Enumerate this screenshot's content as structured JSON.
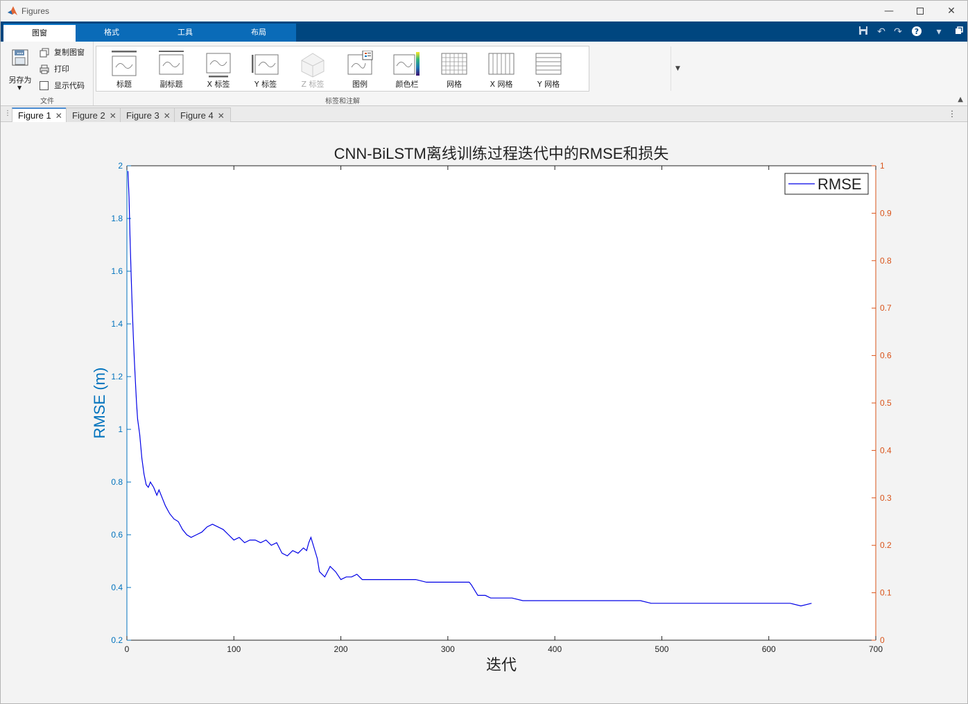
{
  "window": {
    "title": "Figures"
  },
  "ribbon": {
    "tabs": [
      "图窗",
      "格式",
      "工具",
      "布局"
    ],
    "file_section": {
      "save_as": "另存为",
      "copy_figure": "复制图窗",
      "print": "打印",
      "show_code": "显示代码",
      "label": "文件"
    },
    "annotation_section": {
      "label": "标签和注解",
      "items": [
        {
          "label": "标题",
          "icon": "title-icon",
          "enabled": true
        },
        {
          "label": "副标题",
          "icon": "subtitle-icon",
          "enabled": true
        },
        {
          "label": "X 标签",
          "icon": "xlabel-icon",
          "enabled": true
        },
        {
          "label": "Y 标签",
          "icon": "ylabel-icon",
          "enabled": true
        },
        {
          "label": "Z 标签",
          "icon": "zlabel-icon",
          "enabled": false
        },
        {
          "label": "图例",
          "icon": "legend-icon",
          "enabled": true
        },
        {
          "label": "颜色栏",
          "icon": "colorbar-icon",
          "enabled": true
        },
        {
          "label": "网格",
          "icon": "grid-icon",
          "enabled": true
        },
        {
          "label": "X 网格",
          "icon": "xgrid-icon",
          "enabled": true
        },
        {
          "label": "Y 网格",
          "icon": "ygrid-icon",
          "enabled": true
        }
      ]
    }
  },
  "doc_tabs": [
    {
      "label": "Figure 1",
      "active": true
    },
    {
      "label": "Figure 2",
      "active": false
    },
    {
      "label": "Figure 3",
      "active": false
    },
    {
      "label": "Figure 4",
      "active": false
    }
  ],
  "chart_data": {
    "type": "line",
    "title": "CNN-BiLSTM离线训练过程迭代中的RMSE和损失",
    "xlabel": "迭代",
    "ylabel": "RMSE (m)",
    "xlim": [
      0,
      700
    ],
    "ylim": [
      0.2,
      2
    ],
    "y2lim": [
      0,
      1
    ],
    "xticks": [
      "0",
      "100",
      "200",
      "300",
      "400",
      "500",
      "600",
      "700"
    ],
    "yticks": [
      "0.2",
      "0.4",
      "0.6",
      "0.8",
      "1",
      "1.2",
      "1.4",
      "1.6",
      "1.8",
      "2"
    ],
    "y2ticks": [
      "0",
      "0.1",
      "0.2",
      "0.3",
      "0.4",
      "0.5",
      "0.6",
      "0.7",
      "0.8",
      "0.9",
      "1"
    ],
    "legend": {
      "entries": [
        "RMSE"
      ],
      "placement": "top-right"
    },
    "grid": false,
    "colors": {
      "series": "#0000e6",
      "left_axis": "#0072bd",
      "right_axis": "#d95319"
    },
    "series": [
      {
        "name": "RMSE",
        "x": [
          1,
          2,
          3,
          4,
          5,
          6,
          7,
          8,
          9,
          10,
          12,
          14,
          16,
          18,
          20,
          22,
          25,
          28,
          30,
          33,
          36,
          40,
          44,
          48,
          52,
          56,
          60,
          65,
          70,
          75,
          80,
          85,
          90,
          95,
          100,
          105,
          110,
          115,
          120,
          125,
          130,
          135,
          140,
          145,
          150,
          155,
          160,
          165,
          168,
          170,
          172,
          175,
          178,
          180,
          185,
          190,
          195,
          200,
          205,
          210,
          215,
          220,
          230,
          240,
          250,
          260,
          270,
          280,
          290,
          300,
          310,
          320,
          322,
          325,
          328,
          330,
          335,
          340,
          350,
          360,
          370,
          380,
          390,
          400,
          420,
          440,
          460,
          480,
          490,
          500,
          520,
          540,
          560,
          580,
          600,
          620,
          630,
          640
        ],
        "y": [
          1.98,
          1.88,
          1.72,
          1.58,
          1.46,
          1.35,
          1.26,
          1.18,
          1.1,
          1.04,
          0.98,
          0.89,
          0.83,
          0.79,
          0.78,
          0.8,
          0.78,
          0.75,
          0.77,
          0.74,
          0.71,
          0.68,
          0.66,
          0.65,
          0.62,
          0.6,
          0.59,
          0.6,
          0.61,
          0.63,
          0.64,
          0.63,
          0.62,
          0.6,
          0.58,
          0.59,
          0.57,
          0.58,
          0.58,
          0.57,
          0.58,
          0.56,
          0.57,
          0.53,
          0.52,
          0.54,
          0.53,
          0.55,
          0.54,
          0.57,
          0.59,
          0.55,
          0.51,
          0.46,
          0.44,
          0.48,
          0.46,
          0.43,
          0.44,
          0.44,
          0.45,
          0.43,
          0.43,
          0.43,
          0.43,
          0.43,
          0.43,
          0.42,
          0.42,
          0.42,
          0.42,
          0.42,
          0.41,
          0.39,
          0.37,
          0.37,
          0.37,
          0.36,
          0.36,
          0.36,
          0.35,
          0.35,
          0.35,
          0.35,
          0.35,
          0.35,
          0.35,
          0.35,
          0.34,
          0.34,
          0.34,
          0.34,
          0.34,
          0.34,
          0.34,
          0.34,
          0.33,
          0.34
        ]
      }
    ]
  }
}
